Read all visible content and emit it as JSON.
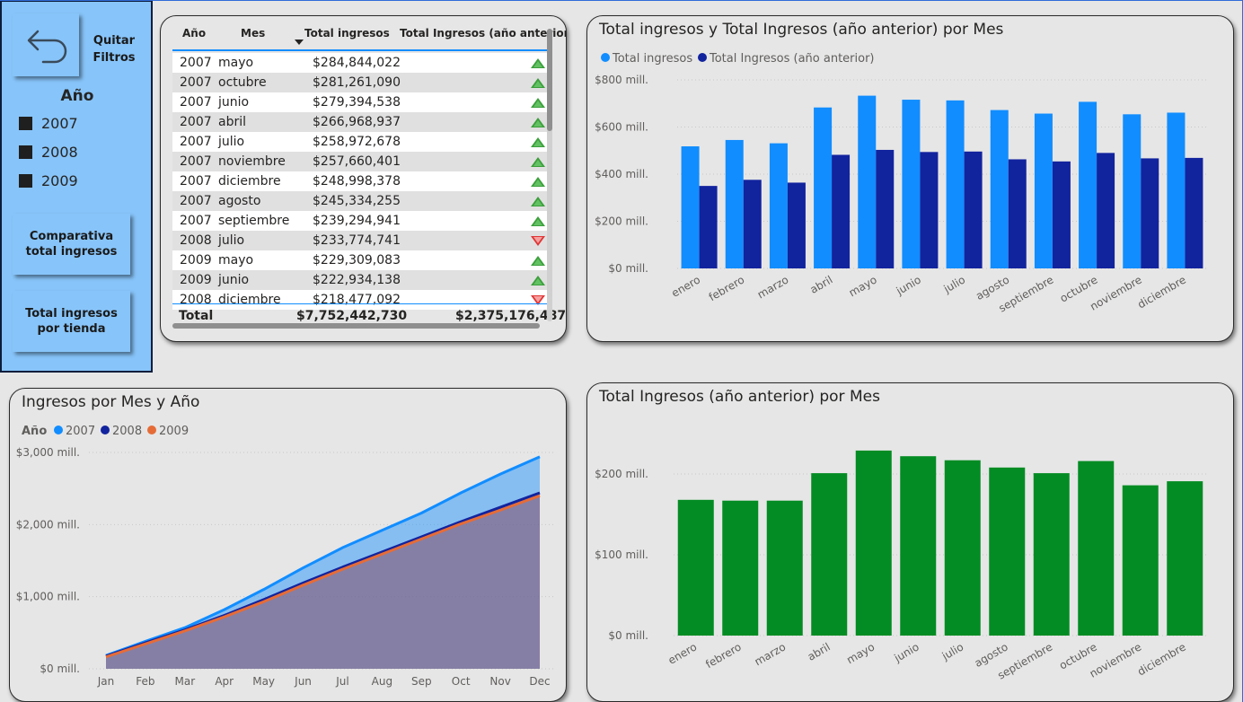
{
  "side_panel": {
    "quitar_label": "Quitar\nFiltros",
    "slicer_title": "Año",
    "years": [
      "2007",
      "2008",
      "2009"
    ],
    "btn_comparativa": "Comparativa\ntotal ingresos",
    "btn_tienda": "Total ingresos\npor tienda"
  },
  "table": {
    "headers": [
      "Año",
      "Mes",
      "Total ingresos",
      "Total Ingresos (año anterior)"
    ],
    "rows": [
      {
        "anio": "2007",
        "mes": "mayo",
        "total": "$284,844,022",
        "trend": "up"
      },
      {
        "anio": "2007",
        "mes": "octubre",
        "total": "$281,261,090",
        "trend": "up"
      },
      {
        "anio": "2007",
        "mes": "junio",
        "total": "$279,394,538",
        "trend": "up"
      },
      {
        "anio": "2007",
        "mes": "abril",
        "total": "$266,968,937",
        "trend": "up"
      },
      {
        "anio": "2007",
        "mes": "julio",
        "total": "$258,972,678",
        "trend": "up"
      },
      {
        "anio": "2007",
        "mes": "noviembre",
        "total": "$257,660,401",
        "trend": "up"
      },
      {
        "anio": "2007",
        "mes": "diciembre",
        "total": "$248,998,378",
        "trend": "up"
      },
      {
        "anio": "2007",
        "mes": "agosto",
        "total": "$245,334,255",
        "trend": "up"
      },
      {
        "anio": "2007",
        "mes": "septiembre",
        "total": "$239,294,941",
        "trend": "up"
      },
      {
        "anio": "2008",
        "mes": "julio",
        "total": "$233,774,741",
        "trend": "down"
      },
      {
        "anio": "2009",
        "mes": "mayo",
        "total": "$229,309,083",
        "trend": "up"
      },
      {
        "anio": "2009",
        "mes": "junio",
        "total": "$222,934,138",
        "trend": "up"
      },
      {
        "anio": "2008",
        "mes": "diciembre",
        "total": "$218,477,092",
        "trend": "down"
      }
    ],
    "total_label": "Total",
    "total_ingresos": "$7,752,442,730",
    "total_anterior": "$2,375,176,487"
  },
  "colors": {
    "ingresos": "#118dff",
    "anterior": "#12239e",
    "green": "#038c23",
    "y2009": "#e66c37",
    "up": "#3b9f3b",
    "down": "#e03434"
  },
  "chart_data": [
    {
      "type": "bar",
      "title": "Total ingresos y Total Ingresos (año anterior) por Mes",
      "categories": [
        "enero",
        "febrero",
        "marzo",
        "abril",
        "mayo",
        "junio",
        "julio",
        "agosto",
        "septiembre",
        "octubre",
        "noviembre",
        "diciembre"
      ],
      "series": [
        {
          "name": "Total ingresos",
          "values": [
            518,
            545,
            531,
            683,
            733,
            716,
            713,
            672,
            657,
            707,
            654,
            661
          ]
        },
        {
          "name": "Total Ingresos (año anterior)",
          "values": [
            350,
            376,
            364,
            482,
            503,
            494,
            496,
            463,
            454,
            490,
            467,
            469
          ]
        }
      ],
      "ylim": [
        0,
        800
      ],
      "yticks": [
        "$0 mill.",
        "$200 mill.",
        "$400 mill.",
        "$600 mill.",
        "$800 mill."
      ],
      "legend": "top-left",
      "grid": true
    },
    {
      "type": "area",
      "title": "Ingresos por Mes y Año",
      "legend_title": "Año",
      "categories": [
        "Jan",
        "Feb",
        "Mar",
        "Apr",
        "May",
        "Jun",
        "Jul",
        "Aug",
        "Sep",
        "Oct",
        "Nov",
        "Dec"
      ],
      "series": [
        {
          "name": "2007",
          "values": [
            185,
            380,
            570,
            820,
            1100,
            1400,
            1680,
            1920,
            2160,
            2440,
            2700,
            2940
          ]
        },
        {
          "name": "2008",
          "values": [
            175,
            360,
            540,
            740,
            960,
            1190,
            1410,
            1620,
            1830,
            2040,
            2240,
            2440
          ]
        },
        {
          "name": "2009",
          "values": [
            165,
            345,
            525,
            720,
            930,
            1160,
            1380,
            1590,
            1800,
            2010,
            2200,
            2400
          ]
        }
      ],
      "ylim": [
        0,
        3000
      ],
      "yticks": [
        "$0 mill.",
        "$1,000 mill.",
        "$2,000 mill.",
        "$3,000 mill."
      ],
      "legend": "top-left",
      "grid": true
    },
    {
      "type": "bar",
      "title": "Total Ingresos (año anterior) por Mes",
      "categories": [
        "enero",
        "febrero",
        "marzo",
        "abril",
        "mayo",
        "junio",
        "julio",
        "agosto",
        "septiembre",
        "octubre",
        "noviembre",
        "diciembre"
      ],
      "values": [
        168,
        167,
        167,
        201,
        229,
        222,
        217,
        208,
        201,
        216,
        186,
        191
      ],
      "ylim": [
        0,
        250
      ],
      "yticks": [
        "$0 mill.",
        "$100 mill.",
        "$200 mill."
      ],
      "grid": true
    }
  ]
}
